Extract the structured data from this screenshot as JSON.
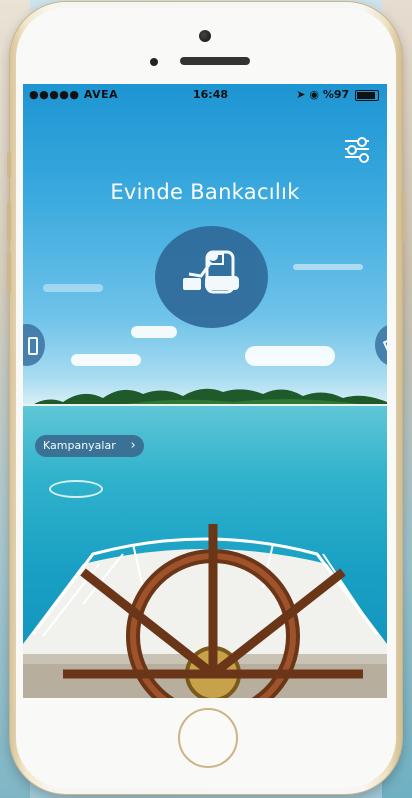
{
  "status_bar": {
    "carrier": "●●●●● AVEA",
    "time": "16:48",
    "battery": "%97"
  },
  "main": {
    "title": "Evinde Bankacılık",
    "campaigns_label": "Kampanyalar",
    "campaigns_chevron": "›"
  },
  "icons": {
    "settings": "sliders-icon",
    "home_banking": "armchair-icon",
    "left_nav": "tablet-icon",
    "right_nav": "card-icon"
  },
  "colors": {
    "sky": "#2a9ad5",
    "circle": "#2f6a9a",
    "pill": "#3a6f93"
  }
}
